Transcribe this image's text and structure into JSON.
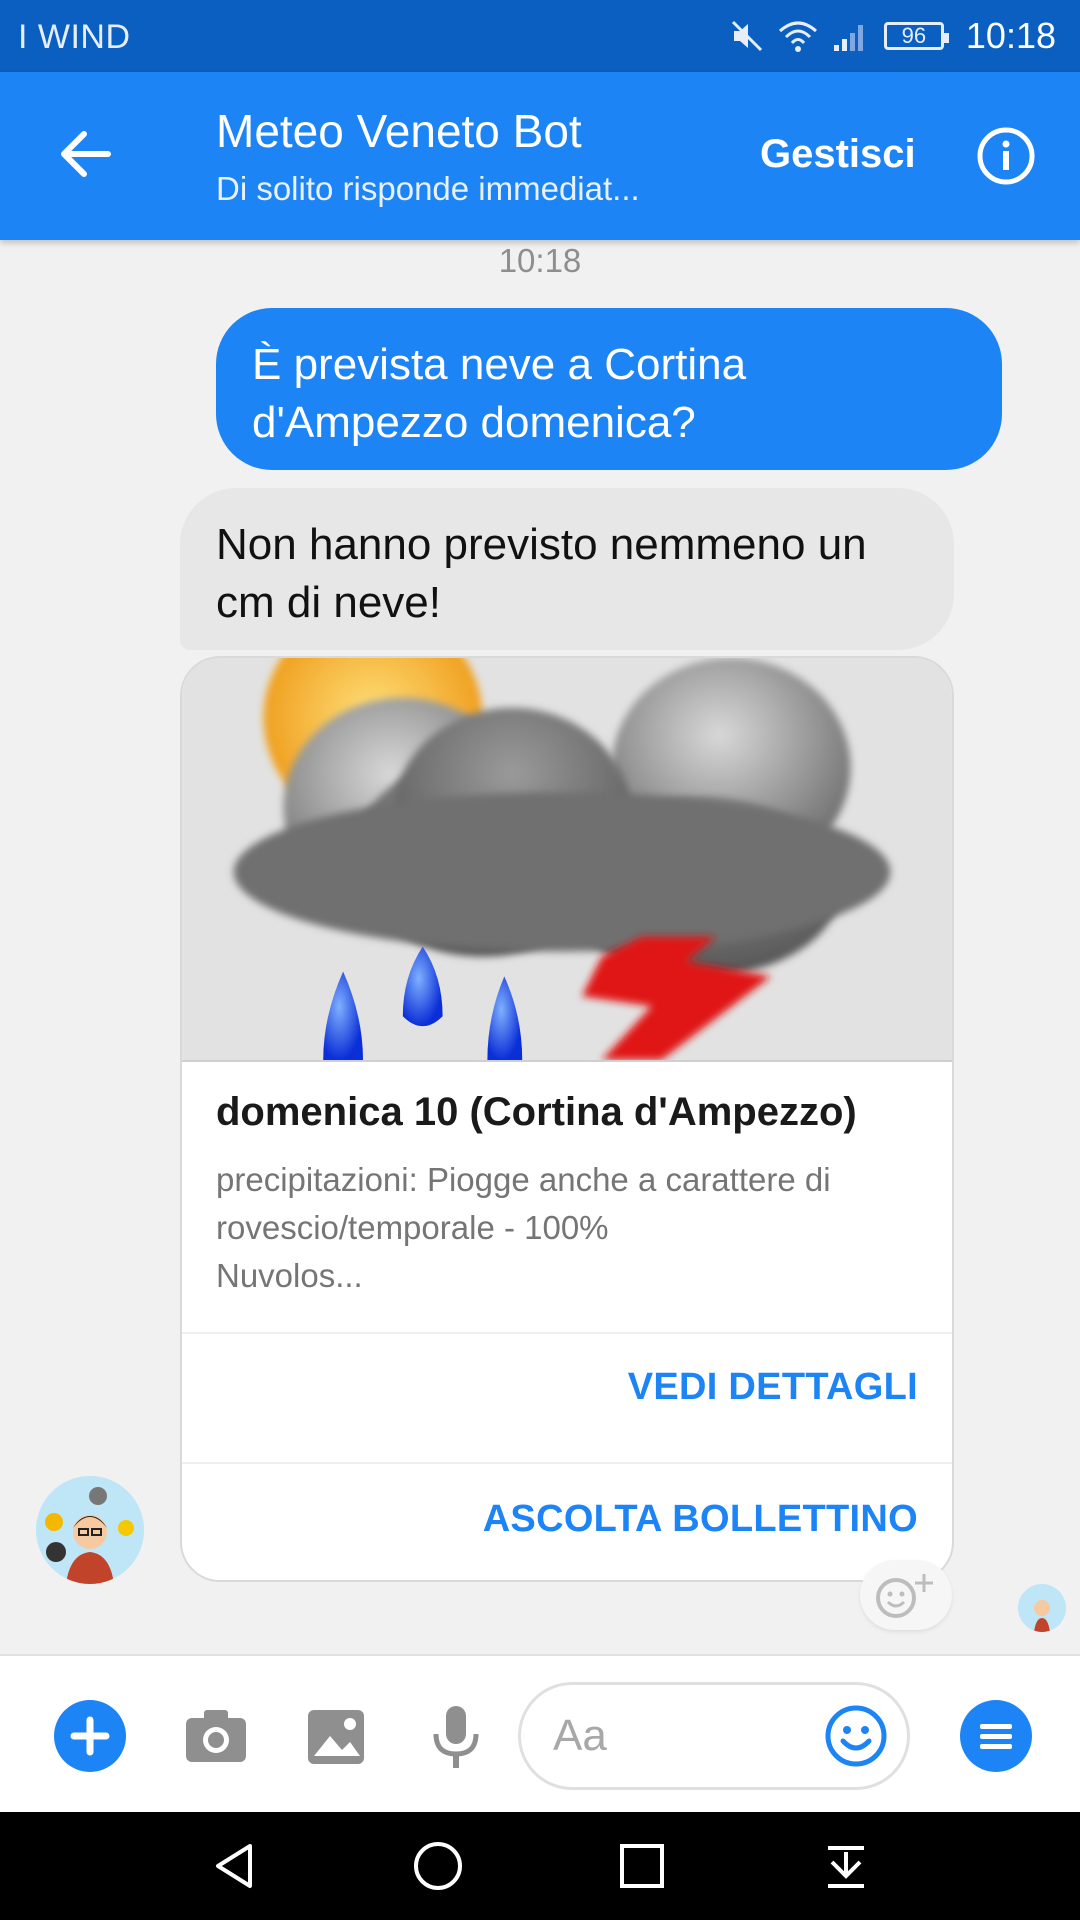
{
  "status_bar": {
    "carrier": "I WIND",
    "battery": "96",
    "time": "10:18"
  },
  "header": {
    "title": "Meteo Veneto Bot",
    "subtitle": "Di solito risponde immediat...",
    "manage_label": "Gestisci"
  },
  "chat": {
    "timestamp": "10:18",
    "outgoing_message": "È prevista neve a Cortina d'Ampezzo domenica?",
    "incoming_message": "Non hanno previsto nemmeno un cm di neve!",
    "card": {
      "title": "domenica 10 (Cortina d'Ampezzo)",
      "description_line1": "precipitazioni: Piogge anche a carattere di",
      "description_line2": "rovescio/temporale - 100%",
      "description_line3": "Nuvolos...",
      "button1": "VEDI DETTAGLI",
      "button2": "ASCOLTA BOLLETTINO"
    }
  },
  "composer": {
    "placeholder": "Aa"
  },
  "icons": {
    "back": "arrow-left-icon",
    "info": "info-icon",
    "plus": "plus-icon",
    "camera": "camera-icon",
    "image": "image-icon",
    "mic": "microphone-icon",
    "emoji": "emoji-icon",
    "menu": "menu-icon"
  },
  "colors": {
    "brand": "#1d84f5",
    "status_bar": "#0a5fc0",
    "incoming_bubble": "#e7e7e7"
  }
}
